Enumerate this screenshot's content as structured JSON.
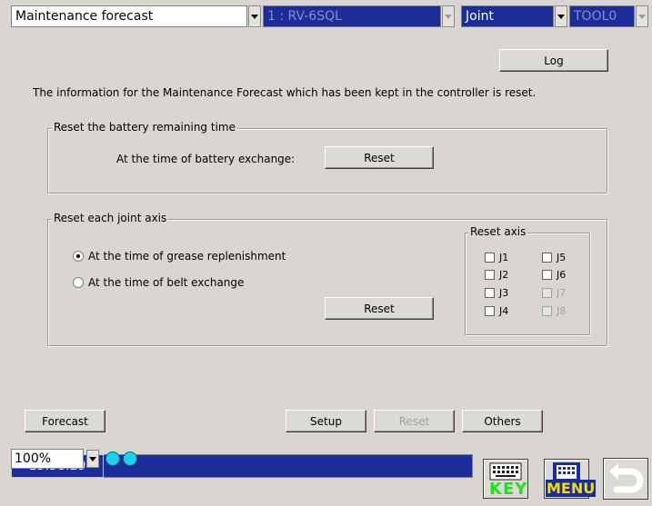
{
  "topbar": {
    "mode": "Maintenance forecast",
    "robot": "1 : RV-6SQL",
    "coord": "Joint",
    "tool": "TOOL0"
  },
  "log_button": "Log",
  "info_text": "The information for the Maintenance Forecast which has been kept in the controller is reset.",
  "battery_group": {
    "title": "Reset the battery remaining time",
    "label": "At the time of battery exchange:",
    "button": "Reset"
  },
  "joint_group": {
    "title": "Reset each joint axis",
    "options": [
      {
        "label": "At the time of grease replenishment",
        "selected": true
      },
      {
        "label": "At the time of belt exchange",
        "selected": false
      }
    ],
    "button": "Reset",
    "axis_group": {
      "title": "Reset axis",
      "axes": [
        {
          "label": "J1",
          "enabled": true,
          "checked": false
        },
        {
          "label": "J2",
          "enabled": true,
          "checked": false
        },
        {
          "label": "J3",
          "enabled": true,
          "checked": false
        },
        {
          "label": "J4",
          "enabled": true,
          "checked": false
        },
        {
          "label": "J5",
          "enabled": true,
          "checked": false
        },
        {
          "label": "J6",
          "enabled": true,
          "checked": false
        },
        {
          "label": "J7",
          "enabled": false,
          "checked": false
        },
        {
          "label": "J8",
          "enabled": false,
          "checked": false
        }
      ]
    }
  },
  "bottom_buttons": {
    "forecast": "Forecast",
    "setup": "Setup",
    "reset": "Reset",
    "others": "Others"
  },
  "status": {
    "zoom": "100%",
    "time": "15:58:29",
    "key_label": "KEY",
    "menu_label": "MENU"
  },
  "colors": {
    "background": "#d9d5d0",
    "selector_blue": "#1c2d99",
    "indicator_cyan": "#1ed0e8",
    "key_green": "#19e419",
    "menu_yellow": "#f0e000"
  }
}
